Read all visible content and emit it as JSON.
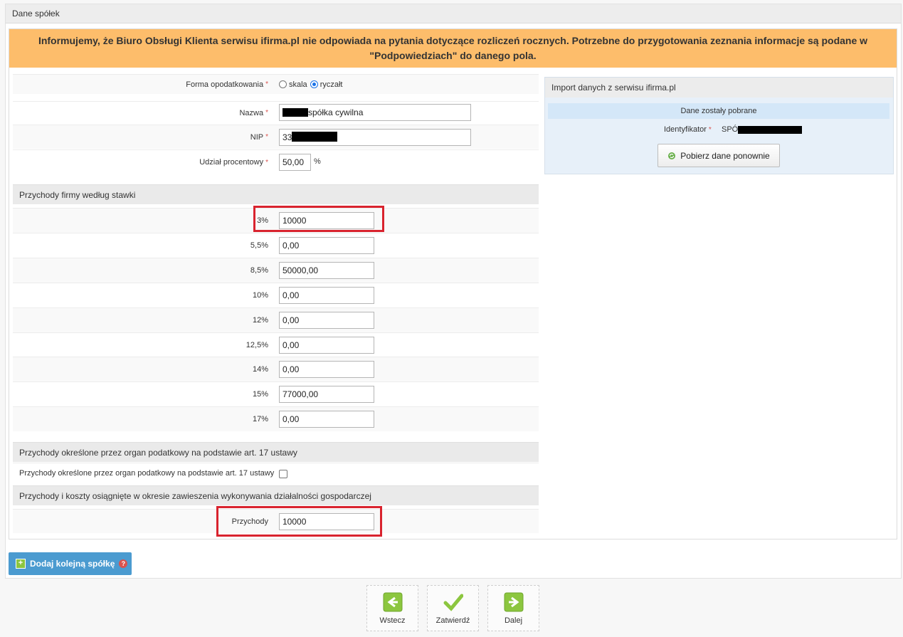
{
  "panel_title": "Dane spółek",
  "banner_text": "Informujemy, że Biuro Obsługi Klienta serwisu ifirma.pl nie odpowiada na pytania dotyczące rozliczeń rocznych. Potrzebne do przygotowania zeznania informacje są podane w \"Podpowiedziach\" do danego pola.",
  "form": {
    "tax_form_label": "Forma opodatkowania",
    "radio_skala": "skala",
    "radio_ryczalt": "ryczałt",
    "selected_tax_form": "ryczałt",
    "name_label": "Nazwa",
    "name_value": "spółka cywilna",
    "nip_label": "NIP",
    "nip_value": "33",
    "share_label": "Udział procentowy",
    "share_value": "50,00",
    "share_unit": "%",
    "required_mark": "*"
  },
  "revenue_section": {
    "title": "Przychody firmy według stawki",
    "rows": [
      {
        "rate": "3%",
        "value": "10000"
      },
      {
        "rate": "5,5%",
        "value": "0,00"
      },
      {
        "rate": "8,5%",
        "value": "50000,00"
      },
      {
        "rate": "10%",
        "value": "0,00"
      },
      {
        "rate": "12%",
        "value": "0,00"
      },
      {
        "rate": "12,5%",
        "value": "0,00"
      },
      {
        "rate": "14%",
        "value": "0,00"
      },
      {
        "rate": "15%",
        "value": "77000,00"
      },
      {
        "rate": "17%",
        "value": "0,00"
      }
    ]
  },
  "art17_section": {
    "title": "Przychody określone przez organ podatkowy na podstawie art. 17 ustawy",
    "checkbox_label": "Przychody określone przez organ podatkowy na podstawie art. 17 ustawy",
    "checked": false
  },
  "suspension_section": {
    "title": "Przychody i koszty osiągnięte w okresie zawieszenia wykonywania działalności gospodarczej",
    "revenue_label": "Przychody",
    "revenue_value": "10000"
  },
  "import_box": {
    "title": "Import danych z serwisu ifirma.pl",
    "status": "Dane zostały pobrane",
    "id_label": "Identyfikator",
    "id_value": "SPÓ",
    "refresh_button": "Pobierz dane ponownie"
  },
  "add_company_button": "Dodaj kolejną spółkę",
  "help_glyph": "?",
  "plus_glyph": "+",
  "nav": {
    "back": "Wstecz",
    "confirm": "Zatwierdź",
    "next": "Dalej"
  },
  "colors": {
    "banner": "#fdbd6b",
    "highlight": "#d9232e",
    "add_button": "#4b9bd0",
    "nav_green": "#8cc63f"
  }
}
